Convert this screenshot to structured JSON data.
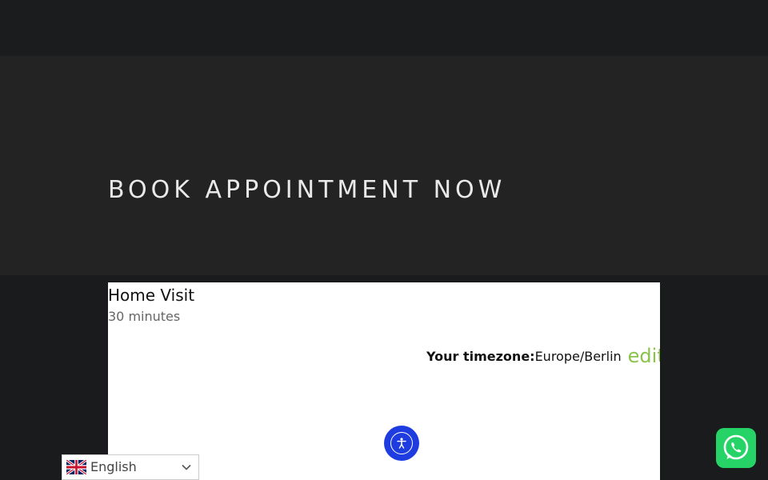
{
  "hero": {
    "title": "BOOK APPOINTMENT NOW"
  },
  "booking": {
    "service_name": "Home Visit",
    "duration": "30 minutes",
    "timezone_label": "Your timezone:",
    "timezone_value": "Europe/Berlin",
    "edit_label": "edit"
  },
  "language_switcher": {
    "selected": "English",
    "flag": "uk-flag-icon"
  },
  "widgets": {
    "accessibility_icon": "accessibility-icon",
    "whatsapp_icon": "whatsapp-icon"
  },
  "colors": {
    "accent_green": "#8bc34a",
    "accessibility_blue": "#1e3ce0",
    "whatsapp_green": "#25d366"
  }
}
